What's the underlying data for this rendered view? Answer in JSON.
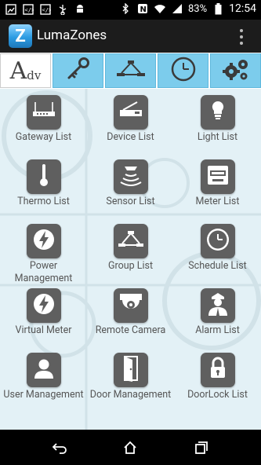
{
  "status": {
    "battery": "83%",
    "time": "12:54"
  },
  "app": {
    "title": "LumaZones",
    "logo_letter": "Z"
  },
  "tabs": [
    {
      "label_big": "A",
      "label_small": "dv"
    },
    {
      "icon": "key-icon"
    },
    {
      "icon": "group-icon"
    },
    {
      "icon": "clock-icon"
    },
    {
      "icon": "gears-icon"
    }
  ],
  "grid": {
    "items": [
      {
        "label": "Gateway List",
        "icon": "gateway-icon"
      },
      {
        "label": "Device List",
        "icon": "device-icon"
      },
      {
        "label": "Light List",
        "icon": "light-bulb-icon"
      },
      {
        "label": "Thermo List",
        "icon": "thermometer-icon"
      },
      {
        "label": "Sensor List",
        "icon": "sensor-icon"
      },
      {
        "label": "Meter List",
        "icon": "meter-icon"
      },
      {
        "label": "Power Management",
        "icon": "power-icon"
      },
      {
        "label": "Group List",
        "icon": "group-icon"
      },
      {
        "label": "Schedule List",
        "icon": "clock-icon"
      },
      {
        "label": "Virtual Meter",
        "icon": "power-icon"
      },
      {
        "label": "Remote Camera",
        "icon": "camera-icon"
      },
      {
        "label": "Alarm List",
        "icon": "guard-icon"
      },
      {
        "label": "User Management",
        "icon": "user-icon"
      },
      {
        "label": "Door Management",
        "icon": "door-icon"
      },
      {
        "label": "DoorLock List",
        "icon": "lock-icon"
      }
    ]
  }
}
